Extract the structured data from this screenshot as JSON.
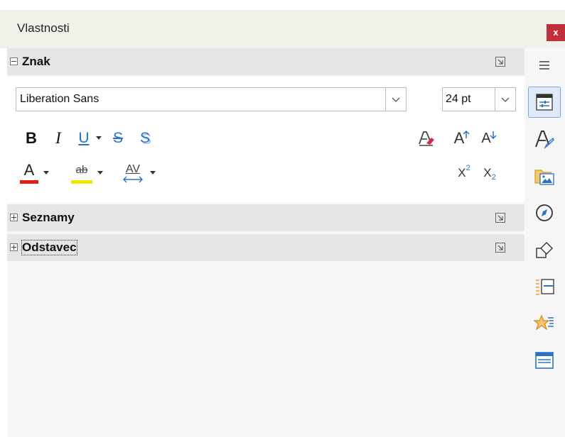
{
  "window": {
    "title": "Vlastnosti",
    "close_label": "x"
  },
  "sections": {
    "znak": {
      "title": "Znak"
    },
    "seznamy": {
      "title": "Seznamy"
    },
    "odstavec": {
      "title": "Odstavec"
    }
  },
  "character": {
    "font_name": "Liberation Sans",
    "font_size": "24 pt",
    "toolbar1": {
      "bold": "B",
      "italic": "I",
      "underline": "U",
      "strikethrough": "S",
      "shadow": "S",
      "grow": "A",
      "shrink": "A"
    },
    "toolbar2": {
      "font_color": "A",
      "highlight": "ab",
      "spacing": "AV",
      "superscript": "X",
      "superscript_exp": "2",
      "subscript": "X",
      "subscript_exp": "2"
    }
  },
  "colors": {
    "font_color": "#e31b1b",
    "highlight_color": "#f2e600",
    "accent_blue": "#2a73c7",
    "close_red": "#c22f3a"
  },
  "sidebar_icons": [
    "menu-icon",
    "properties-icon",
    "styles-icon",
    "gallery-icon",
    "navigator-icon",
    "shapes-icon",
    "page-icon",
    "animation-icon",
    "slide-transition-icon"
  ]
}
